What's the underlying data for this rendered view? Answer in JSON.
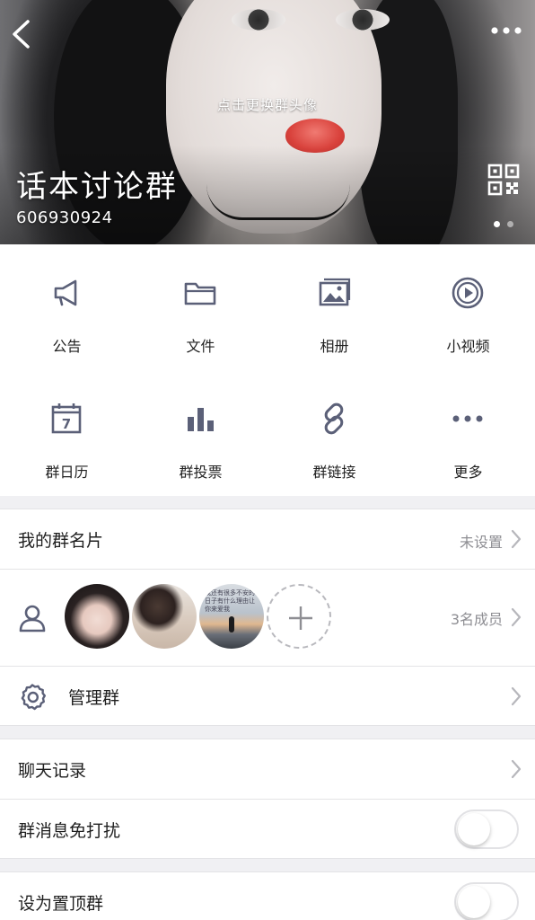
{
  "header": {
    "avatar_hint": "点击更换群头像",
    "group_name": "话本讨论群",
    "group_id": "606930924",
    "icons": {
      "back": "chevron-left-icon",
      "more": "more-dots-icon",
      "qr": "qr-code-icon"
    },
    "pager": {
      "count": 2,
      "active": 0
    }
  },
  "features": [
    {
      "label": "公告",
      "icon": "megaphone-icon"
    },
    {
      "label": "文件",
      "icon": "folder-icon"
    },
    {
      "label": "相册",
      "icon": "photo-album-icon"
    },
    {
      "label": "小视频",
      "icon": "video-play-icon"
    },
    {
      "label": "群日历",
      "icon": "calendar-icon",
      "icon_text": "7"
    },
    {
      "label": "群投票",
      "icon": "bar-chart-icon"
    },
    {
      "label": "群链接",
      "icon": "link-icon"
    },
    {
      "label": "更多",
      "icon": "more-icon"
    }
  ],
  "card": {
    "title": "我的群名片",
    "value": "未设置"
  },
  "members": {
    "count_label": "3名成员",
    "icon": "members-icon",
    "avatars": [
      "member-avatar-1",
      "member-avatar-2",
      "member-avatar-3"
    ],
    "avatar3_text": "我还有很多不安的日子有什么理由让你来爱我"
  },
  "manage": {
    "title": "管理群",
    "icon": "gear-icon"
  },
  "chat_history": {
    "title": "聊天记录"
  },
  "mute": {
    "title": "群消息免打扰",
    "on": false
  },
  "pin": {
    "title": "设为置顶群",
    "on": false
  },
  "colors": {
    "icon_gray": "#5b6078",
    "toggle_border": "#e2e2e5",
    "secondary_text": "#8e8e93"
  }
}
